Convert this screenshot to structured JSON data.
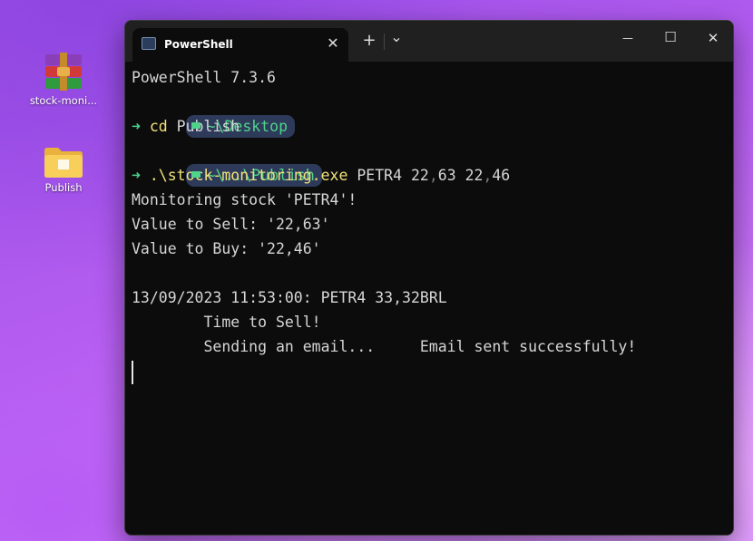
{
  "desktop": {
    "icons": [
      {
        "label": "stock-moni...",
        "icon": "winrar-archive-icon"
      },
      {
        "label": "Publish",
        "icon": "folder-icon"
      }
    ]
  },
  "window": {
    "tab_title": "PowerShell",
    "tab_close": "✕",
    "new_tab": "+",
    "dropdown": "⌄",
    "minimize": "—",
    "maximize": "☐",
    "close": "✕"
  },
  "terminal": {
    "version_line": "PowerShell 7.3.6",
    "prompt1_path": "~\\Desktop",
    "prompt_arrow": "➜",
    "cmd1_name": "cd",
    "cmd1_args": " Publish",
    "prompt2_path": "~\\..\\Publish",
    "cmd2_name": ".\\stock-monitoring.exe",
    "cmd2_arg1": " PETR4 22",
    "cmd2_sep1": ",",
    "cmd2_arg2": "63 22",
    "cmd2_sep2": ",",
    "cmd2_arg3": "46",
    "output": [
      "Monitoring stock 'PETR4'!",
      "Value to Sell: '22,63'",
      "Value to Buy: '22,46'",
      "",
      "13/09/2023 11:53:00: PETR4 33,32BRL",
      "        Time to Sell!",
      "        Sending an email...     Email sent successfully!"
    ]
  },
  "colors": {
    "terminal_bg": "#0c0c0c",
    "prompt_green": "#4fd38a",
    "command_yellow": "#f2e37a",
    "pill_bg": "#2e3a5a"
  }
}
